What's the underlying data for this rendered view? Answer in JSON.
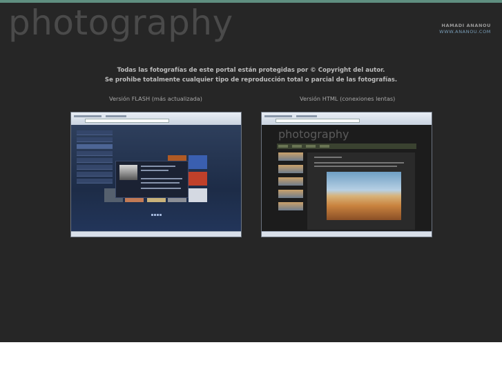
{
  "site": {
    "logo": "photography",
    "author_name": "HAMADI ANANOU",
    "author_site": "WWW.ANANOU.COM",
    "accent_color": "#5f8f80"
  },
  "notice": {
    "line1": "Todas las fotografías de este portal están protegidas por © Copyright del autor.",
    "line2": "Se prohibe totalmente cualquier tipo de reproducción total o parcial de las fotografías."
  },
  "versions": [
    {
      "label": "Versión FLASH (más actualizada)",
      "preview": "flash-version-screenshot"
    },
    {
      "label": "Versión HTML (conexiones lentas)",
      "preview": "html-version-screenshot"
    }
  ]
}
